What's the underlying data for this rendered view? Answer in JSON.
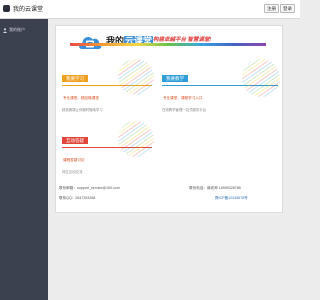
{
  "topbar": {
    "title": "我的云课堂",
    "buttons": [
      "注册",
      "登录"
    ]
  },
  "sidebar": {
    "item_label": "我的账户"
  },
  "banner": {
    "brand_prefix": "我的",
    "brand_highlight": "云课堂",
    "slogan": "构建卓越平台 智慧课堂!"
  },
  "sections": [
    {
      "title": "我要学习",
      "link": "专业课堂、精品微课堂",
      "note": "精品微课让你随时随地学习",
      "color": "#f0a020"
    },
    {
      "title": "我要教学",
      "link": "专业课堂、课程学习入口",
      "note": "在线教学管理一站式服务平台",
      "color": "#2f9ed8"
    },
    {
      "title": "互动答疑",
      "link": "课程答疑讨论",
      "note": "师生互动交流",
      "color": "#e2453c"
    }
  ],
  "footer": {
    "email": "联系邮箱：support_service@163.com",
    "qq": "联系QQ：2847393268",
    "tel": "联系电话：蒋老师 18959328788",
    "icp": "豫ICP备12345678号"
  },
  "colors": {
    "sidebar": "#3c4150",
    "accent_blue": "#3a8fd8",
    "accent_red": "#e03a3a"
  }
}
